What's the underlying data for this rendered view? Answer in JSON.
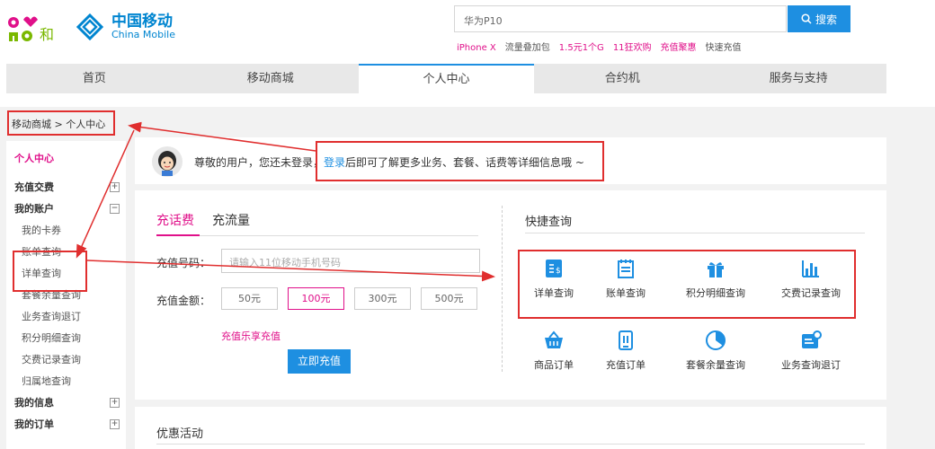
{
  "header": {
    "logo_and_text": "和",
    "logo_cn": "中国移动",
    "logo_en": "China Mobile",
    "search_value": "华为P10",
    "search_button": "搜索",
    "hot_links": [
      {
        "label": "iPhone X",
        "color": "#e0108a"
      },
      {
        "label": "流量叠加包",
        "color": "#555555"
      },
      {
        "label": "1.5元1个G",
        "color": "#e0108a"
      },
      {
        "label": "11狂欢购",
        "color": "#e0108a"
      },
      {
        "label": "充值聚惠",
        "color": "#e0108a"
      },
      {
        "label": "快速充值",
        "color": "#555555"
      }
    ]
  },
  "nav": {
    "items": [
      "首页",
      "移动商城",
      "个人中心",
      "合约机",
      "服务与支持"
    ],
    "active_index": 2
  },
  "breadcrumb": "移动商城 >  个人中心",
  "sidebar": {
    "title": "个人中心",
    "topup": "充值交费",
    "account": "我的账户",
    "account_items": [
      "我的卡券",
      "账单查询",
      "详单查询",
      "套餐余量查询",
      "业务查询退订",
      "积分明细查询",
      "交费记录查询",
      "归属地查询"
    ],
    "info": "我的信息",
    "orders": "我的订单"
  },
  "welcome": {
    "before": "尊敬的用户，您还未登录，",
    "login": "登录",
    "after": "后即可了解更多业务、套餐、话费等详细信息哦 ~"
  },
  "recharge": {
    "tabs": [
      "充话费",
      "充流量"
    ],
    "phone_label": "充值号码：",
    "phone_placeholder": "请输入11位移动手机号码",
    "amount_label": "充值金额：",
    "amounts": [
      "50元",
      "100元",
      "300元",
      "500元"
    ],
    "selected_amount": "100元",
    "promo": "充值乐享充值",
    "submit": "立即充值"
  },
  "quick": {
    "title": "快捷查询",
    "items": [
      {
        "label": "详单查询",
        "icon": "detail-bill-icon"
      },
      {
        "label": "账单查询",
        "icon": "bill-icon"
      },
      {
        "label": "积分明细查询",
        "icon": "gift-icon"
      },
      {
        "label": "交费记录查询",
        "icon": "bar-chart-icon"
      },
      {
        "label": "商品订单",
        "icon": "shopping-basket-icon"
      },
      {
        "label": "充值订单",
        "icon": "recharge-phone-icon"
      },
      {
        "label": "套餐余量查询",
        "icon": "pie-chart-icon"
      },
      {
        "label": "业务查询退订",
        "icon": "service-card-icon"
      }
    ]
  },
  "promotions": {
    "title": "优惠活动"
  },
  "colors": {
    "brand_blue": "#1e8fe1",
    "accent_pink": "#e0108a",
    "annotation_red": "#e02e2e"
  }
}
